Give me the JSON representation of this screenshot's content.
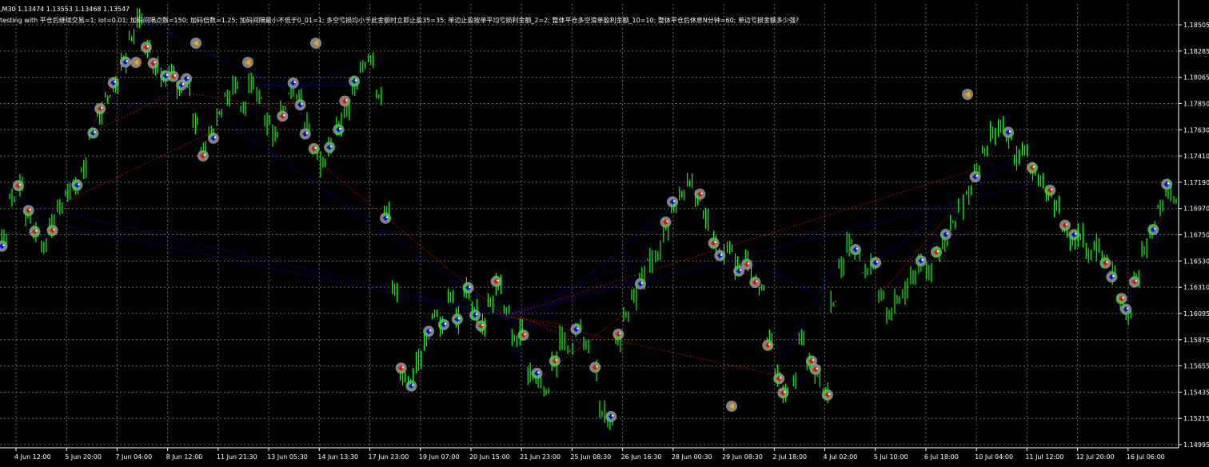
{
  "header": {
    "symbol_line": ",M30  1.13474 1.13553 1.13468 1.13547",
    "ea_params": "testing with 平仓后继续交易=1; lot=0.01; 加码间隔点数=150; 加码倍数=1.25; 加码间隔最小不低于0_01=1; 多空亏损均小于此金额时立即止盈35=35; 单边止盈按单平均亏损利金额_2=2; 整体平仓多空滑单盈利金额_10=10; 整体平仓后休息N分钟=60; 单边亏损金额多少强?"
  },
  "colors": {
    "background": "#000000",
    "grid": "#6a6a6a",
    "bull_candle": "#00ff00",
    "bear_candle": "#00ff00",
    "buy_marker": "#0000ff",
    "sell_marker": "#ff0000",
    "close_marker": "#ffa500",
    "halo": "#9a9a9a",
    "axis_text": "#ffffff"
  },
  "chart_data": {
    "type": "line",
    "title": "",
    "xlabel": "",
    "ylabel": "",
    "x_ticks": [
      "4 Jun 12:00",
      "5 Jun 20:00",
      "7 Jun 04:00",
      "8 Jun 12:00",
      "11 Jun 21:30",
      "13 Jun 05:30",
      "14 Jun 13:30",
      "17 Jun 23:00",
      "19 Jun 07:00",
      "20 Jun 15:00",
      "21 Jun 23:00",
      "25 Jun 08:30",
      "26 Jun 16:30",
      "28 Jun 00:30",
      "29 Jun 08:30",
      "2 Jul 18:00",
      "4 Jul 02:00",
      "5 Jul 10:00",
      "6 Jul 18:00",
      "10 Jul 04:00",
      "11 Jul 12:00",
      "12 Jul 20:00",
      "16 Jul 06:00"
    ],
    "y_ticks": [
      "1.18505",
      "1.18285",
      "1.18065",
      "1.17850",
      "1.17630",
      "1.17410",
      "1.17190",
      "1.16970",
      "1.16750",
      "1.16530",
      "1.16310",
      "1.16095",
      "1.15875",
      "1.15655",
      "1.15435",
      "1.15215",
      "1.14995"
    ],
    "ylim": [
      1.14995,
      1.18505
    ],
    "grid": true,
    "series": [
      {
        "values": [
          1.1672,
          1.1705,
          1.1718,
          1.169,
          1.1678,
          1.1668,
          1.1685,
          1.17,
          1.171,
          1.1715,
          1.173,
          1.176,
          1.1775,
          1.179,
          1.18,
          1.182,
          1.184,
          1.1855,
          1.183,
          1.1815,
          1.1805,
          1.181,
          1.1795,
          1.18,
          1.177,
          1.1745,
          1.176,
          1.1775,
          1.179,
          1.18,
          1.178,
          1.18,
          1.179,
          1.177,
          1.176,
          1.178,
          1.1795,
          1.179,
          1.1765,
          1.1745,
          1.1735,
          1.175,
          1.1765,
          1.178,
          1.18,
          1.1815,
          1.182,
          1.179,
          1.1695,
          1.163,
          1.156,
          1.1555,
          1.157,
          1.159,
          1.161,
          1.16,
          1.1625,
          1.1605,
          1.163,
          1.1615,
          1.16,
          1.162,
          1.1635,
          1.1615,
          1.159,
          1.1595,
          1.156,
          1.1555,
          1.1545,
          1.157,
          1.159,
          1.158,
          1.16,
          1.1585,
          1.1565,
          1.153,
          1.152,
          1.159,
          1.161,
          1.1625,
          1.164,
          1.1655,
          1.166,
          1.168,
          1.17,
          1.171,
          1.172,
          1.1705,
          1.169,
          1.167,
          1.166,
          1.1665,
          1.165,
          1.1655,
          1.164,
          1.163,
          1.159,
          1.156,
          1.1545,
          1.1555,
          1.159,
          1.157,
          1.156,
          1.1545,
          1.162,
          1.165,
          1.167,
          1.166,
          1.1645,
          1.165,
          1.1625,
          1.161,
          1.162,
          1.163,
          1.164,
          1.165,
          1.1645,
          1.166,
          1.167,
          1.1685,
          1.17,
          1.171,
          1.173,
          1.1745,
          1.176,
          1.1765,
          1.1755,
          1.174,
          1.1745,
          1.173,
          1.172,
          1.171,
          1.17,
          1.168,
          1.167,
          1.1675,
          1.166,
          1.1665,
          1.1655,
          1.1645,
          1.162,
          1.161,
          1.164,
          1.1665,
          1.168,
          1.17,
          1.1712,
          1.1705
        ]
      }
    ]
  }
}
